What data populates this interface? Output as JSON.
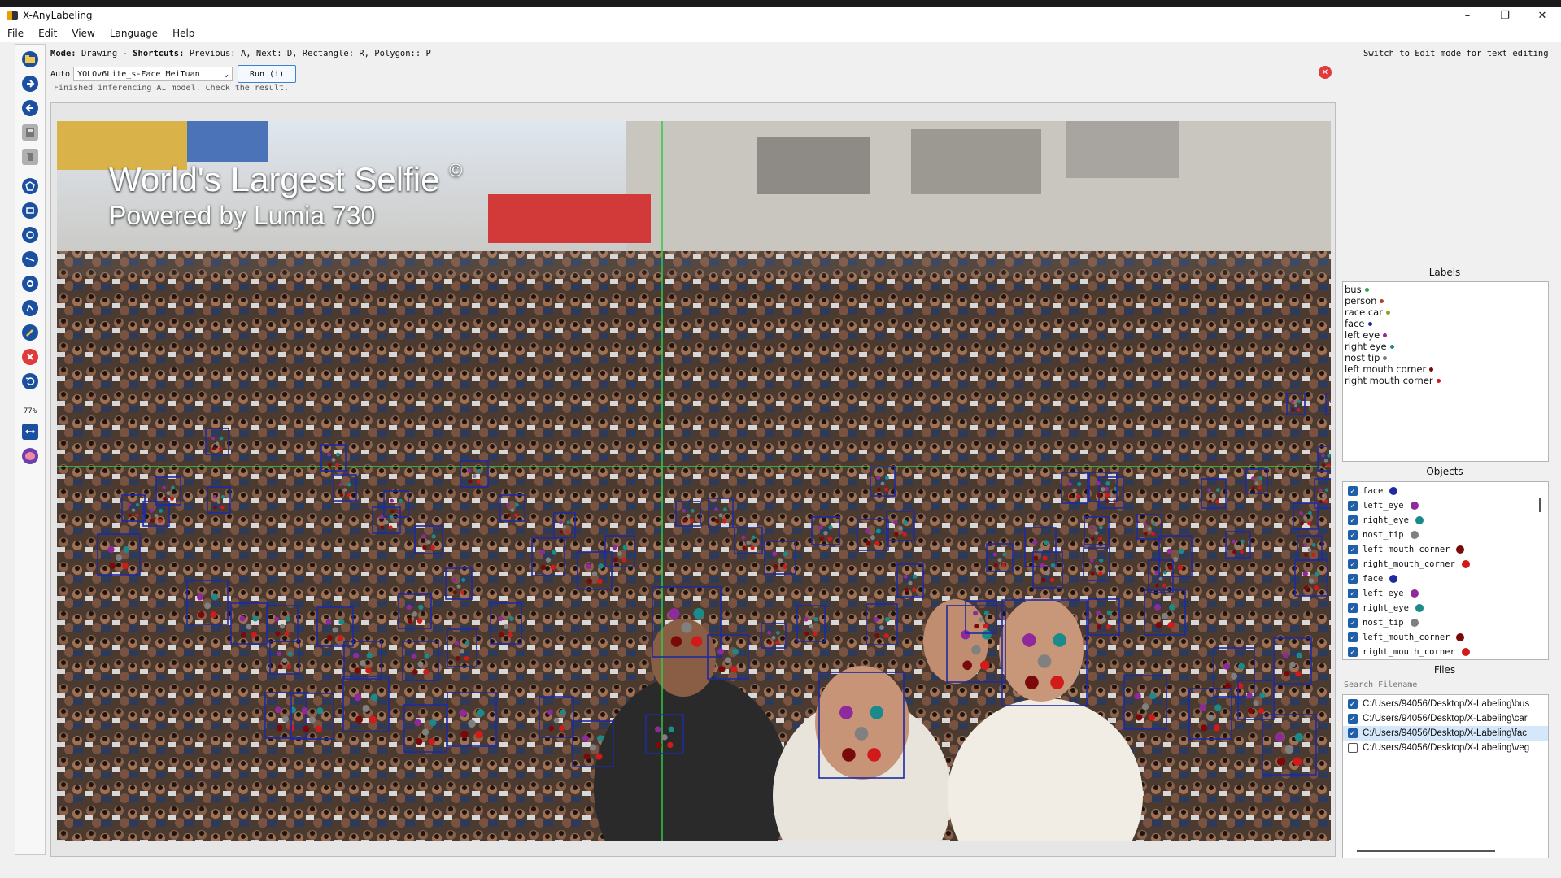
{
  "window": {
    "title": "X-AnyLabeling"
  },
  "menu": [
    "File",
    "Edit",
    "View",
    "Language",
    "Help"
  ],
  "modebar": {
    "mode_label": "Mode:",
    "mode_value": "Drawing",
    "shortcuts_label": "Shortcuts:",
    "shortcuts_text": "Previous: A, Next: D, Rectangle: R, Polygon:: P"
  },
  "right_message": "Switch to Edit mode for text editing",
  "auto": {
    "label": "Auto",
    "model": "YOLOv6Lite_s-Face MeiTuan",
    "run_label": "Run (i)"
  },
  "status": "Finished inferencing AI model. Check the result.",
  "toolbar": {
    "zoom": "77%"
  },
  "image_overlay": {
    "title": "World's Largest Selfie",
    "mark": "©",
    "subtitle": "Powered by Lumia 730"
  },
  "labels_panel": {
    "title": "Labels",
    "items": [
      {
        "name": "bus",
        "color": "#2ea043"
      },
      {
        "name": "person",
        "color": "#c0392b"
      },
      {
        "name": "race car",
        "color": "#9a9a20"
      },
      {
        "name": "face",
        "color": "#1f2aa0"
      },
      {
        "name": "left eye",
        "color": "#8e2a9c"
      },
      {
        "name": "right eye",
        "color": "#1a8a8a"
      },
      {
        "name": "nost tip",
        "color": "#808080"
      },
      {
        "name": "left mouth corner",
        "color": "#7a0a0a"
      },
      {
        "name": "right mouth corner",
        "color": "#d11a1a"
      }
    ]
  },
  "objects_panel": {
    "title": "Objects",
    "items": [
      {
        "name": "face",
        "color": "#1f2aa0"
      },
      {
        "name": "left_eye",
        "color": "#8e2a9c"
      },
      {
        "name": "right_eye",
        "color": "#1a8a8a"
      },
      {
        "name": "nost_tip",
        "color": "#808080"
      },
      {
        "name": "left_mouth_corner",
        "color": "#7a0a0a"
      },
      {
        "name": "right_mouth_corner",
        "color": "#d11a1a"
      },
      {
        "name": "face",
        "color": "#1f2aa0"
      },
      {
        "name": "left_eye",
        "color": "#8e2a9c"
      },
      {
        "name": "right_eye",
        "color": "#1a8a8a"
      },
      {
        "name": "nost_tip",
        "color": "#808080"
      },
      {
        "name": "left_mouth_corner",
        "color": "#7a0a0a"
      },
      {
        "name": "right_mouth_corner",
        "color": "#d11a1a"
      }
    ]
  },
  "files_panel": {
    "title": "Files",
    "search_placeholder": "Search Filename",
    "items": [
      {
        "path": "C:/Users/94056/Desktop/X-Labeling\\bus",
        "checked": true
      },
      {
        "path": "C:/Users/94056/Desktop/X-Labeling\\car",
        "checked": true
      },
      {
        "path": "C:/Users/94056/Desktop/X-Labeling\\fac",
        "checked": true
      },
      {
        "path": "C:/Users/94056/Desktop/X-Labeling\\veg",
        "checked": false
      }
    ]
  },
  "icons": [
    "open-folder-icon",
    "next-image-icon",
    "prev-image-icon",
    "save-icon",
    "delete-icon",
    "polygon-icon",
    "rectangle-icon",
    "circle-icon",
    "line-icon",
    "point-icon",
    "linestrip-icon",
    "edit-icon",
    "delete-shape-icon",
    "undo-icon",
    "fit-width-icon",
    "brain-icon"
  ],
  "colors": {
    "face_box": "#1f2aa0",
    "crosshair": "#2ecc40",
    "accent": "#3b7fd6"
  }
}
